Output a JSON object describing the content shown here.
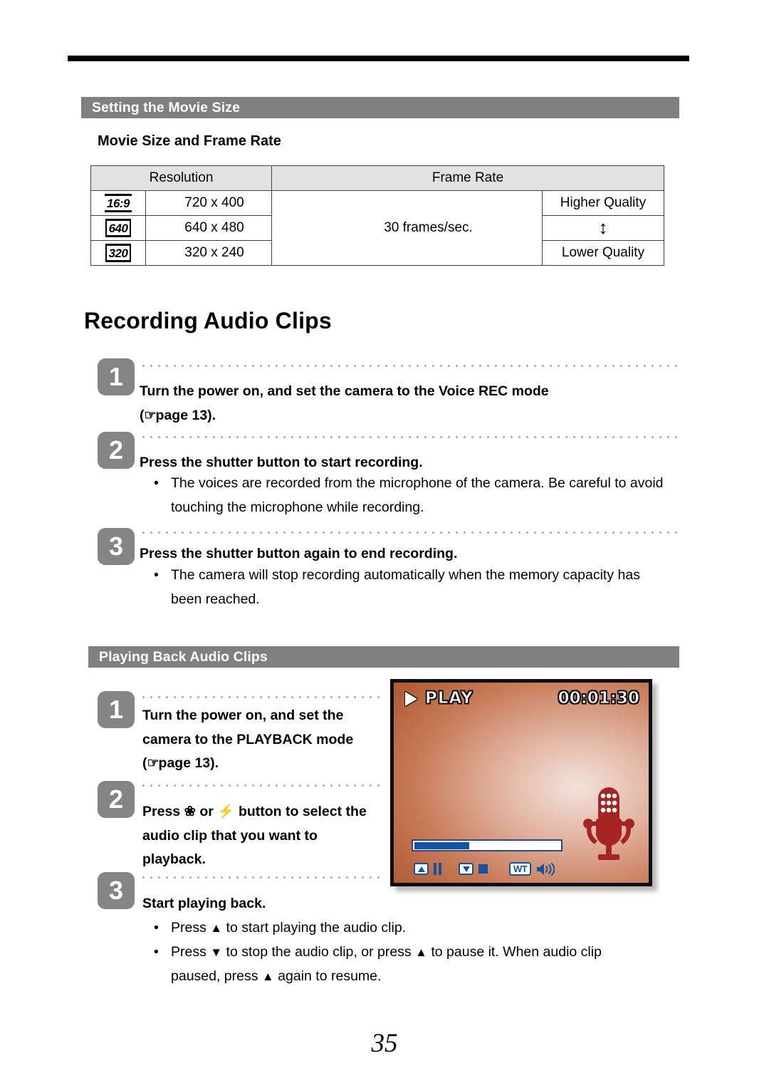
{
  "page": {
    "number": "35"
  },
  "movie_size_section": {
    "bar_title": "Setting the Movie Size",
    "sub_heading": "Movie Size and Frame Rate",
    "table": {
      "headers": [
        "Resolution",
        "Frame Rate"
      ],
      "rows": [
        {
          "badge": "16:9",
          "resolution": "720 x 400",
          "quality": "Higher Quality"
        },
        {
          "badge": "640",
          "resolution": "640 x 480",
          "quality": ""
        },
        {
          "badge": "320",
          "resolution": "320 x 240",
          "quality": "Lower Quality"
        }
      ],
      "frame_rate": "30 frames/sec.",
      "quality_arrow": "↕"
    }
  },
  "recording_section": {
    "title": "Recording Audio Clips",
    "steps": [
      {
        "number": "1",
        "line1": "Turn the power on, and set the camera to the Voice REC mode",
        "line2_prefix": "(",
        "hand_icon": "☞",
        "line2_suffix": "page 13)."
      },
      {
        "number": "2",
        "line1": "Press the shutter button to start recording.",
        "bullets": [
          "The voices are recorded from the microphone of the camera. Be careful to avoid touching the microphone while recording."
        ]
      },
      {
        "number": "3",
        "line1": "Press the shutter button again to end recording.",
        "bullets": [
          "The camera will stop recording automatically when the memory capacity has been reached."
        ]
      }
    ],
    "bullet_char": "•"
  },
  "playback_section": {
    "bar_title": "Playing Back Audio Clips",
    "steps": [
      {
        "number": "1",
        "line1": "Turn the power on, and set the",
        "line2": "camera to the PLAYBACK mode",
        "line3_prefix": "(",
        "hand_icon": "☞",
        "line3_suffix": "page 13)."
      },
      {
        "number": "2",
        "press_word": "Press",
        "macro_icon": "❀",
        "or_word": "or",
        "flash_icon": "⚡",
        "line1_tail": "button to select the",
        "line2": "audio clip that you want to",
        "line3": "playback."
      },
      {
        "number": "3",
        "line1": "Start playing back."
      }
    ],
    "bullets": [
      {
        "pre": "Press",
        "icon": "▲",
        "post": "to start playing the audio clip."
      },
      {
        "pre": "Press",
        "icon": "▼",
        "post": "to stop the audio clip, or press",
        "icon2": "▲",
        "post2": "to pause it. When audio clip",
        "line2_pre": "paused, press",
        "icon3": "▲",
        "line2_post": "again to resume."
      }
    ],
    "bullet_char": "•"
  },
  "lcd": {
    "mode_label": "PLAY",
    "timer": "00:01:30",
    "progress_percent": 38,
    "controls": {
      "play_up": "up-triangle",
      "pause": "pause",
      "down": "down-triangle",
      "stop": "stop",
      "zoom": "WT",
      "speaker": "speaker"
    },
    "colors": {
      "screen_accent": "#b25f39",
      "mic_red": "#a62424",
      "osd_blue": "#14529f"
    }
  }
}
